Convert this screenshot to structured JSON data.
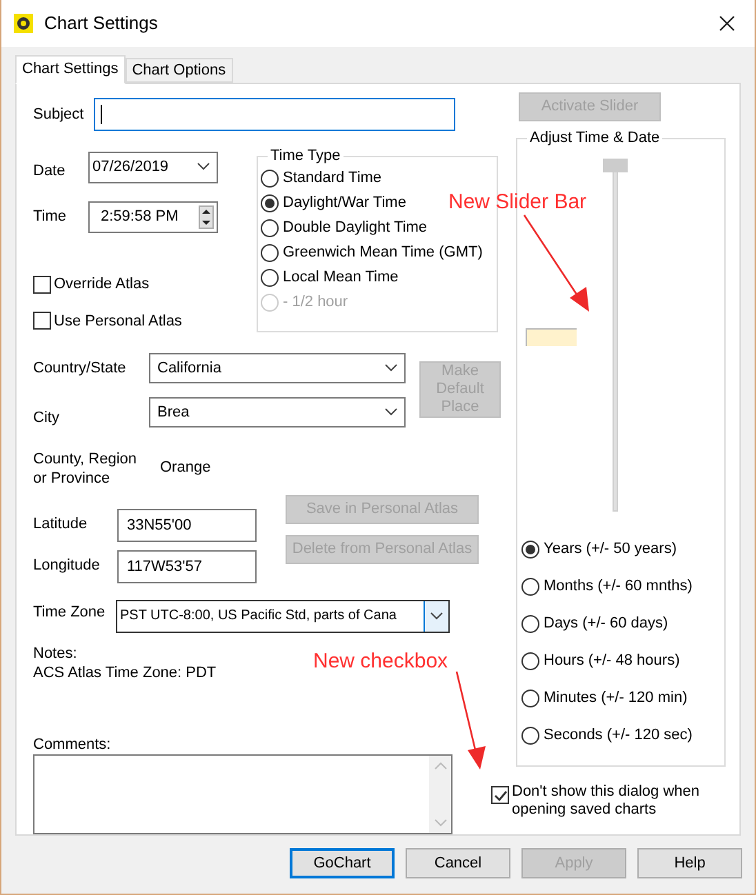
{
  "window": {
    "title": "Chart Settings"
  },
  "tabs": [
    {
      "label": "Chart Settings",
      "selected": true
    },
    {
      "label": "Chart Options",
      "selected": false
    }
  ],
  "subject": {
    "label": "Subject",
    "focused": true
  },
  "date": {
    "label": "Date",
    "value": "07/26/2019"
  },
  "time": {
    "label": "Time",
    "value": "2:59:58 PM"
  },
  "time_type": {
    "title": "Time Type",
    "options": [
      {
        "label": "Standard Time",
        "selected": false,
        "disabled": false
      },
      {
        "label": "Daylight/War Time",
        "selected": true,
        "disabled": false
      },
      {
        "label": "Double Daylight Time",
        "selected": false,
        "disabled": false
      },
      {
        "label": "Greenwich Mean Time (GMT)",
        "selected": false,
        "disabled": false
      },
      {
        "label": "Local Mean Time",
        "selected": false,
        "disabled": false
      },
      {
        "label": "- 1/2 hour",
        "selected": false,
        "disabled": true
      }
    ]
  },
  "checkboxes": [
    {
      "label": "Override Atlas",
      "checked": false
    },
    {
      "label": "Use Personal Atlas",
      "checked": false
    }
  ],
  "country": {
    "label": "Country/State",
    "value": "California"
  },
  "city": {
    "label": "City",
    "value": "Brea"
  },
  "make_default_button": {
    "label": "Make Default Place",
    "disabled": true
  },
  "county": {
    "label": "County, Region or Province",
    "value": "Orange"
  },
  "latitude": {
    "label": "Latitude",
    "value": "33N55'00"
  },
  "longitude": {
    "label": "Longitude",
    "value": "117W53'57"
  },
  "atlas_buttons": [
    {
      "label": "Save in Personal Atlas",
      "disabled": true
    },
    {
      "label": "Delete from Personal Atlas",
      "disabled": true
    }
  ],
  "time_zone": {
    "label": "Time Zone",
    "value": "PST UTC-8:00, US Pacific Std, parts of Cana"
  },
  "notes": {
    "label": "Notes:",
    "text": "ACS Atlas Time Zone: PDT"
  },
  "comments": {
    "label": "Comments:"
  },
  "activate_slider": {
    "label": "Activate Slider",
    "disabled": true
  },
  "adjust": {
    "title": "Adjust Time & Date",
    "slider": {
      "level": 1
    },
    "ranges": [
      {
        "label": "Years (+/- 50 years)",
        "selected": true
      },
      {
        "label": "Months (+/- 60 mnths)",
        "selected": false
      },
      {
        "label": "Days (+/- 60 days)",
        "selected": false
      },
      {
        "label": "Hours (+/- 48 hours)",
        "selected": false
      },
      {
        "label": "Minutes (+/- 120 min)",
        "selected": false
      },
      {
        "label": "Seconds (+/- 120 sec)",
        "selected": false
      }
    ]
  },
  "dont_show": {
    "label": "Don't show this dialog when opening saved charts",
    "checked": true
  },
  "buttons": [
    {
      "label": "GoChart",
      "default": true,
      "disabled": false
    },
    {
      "label": "Cancel",
      "default": false,
      "disabled": false
    },
    {
      "label": "Apply",
      "default": false,
      "disabled": true
    },
    {
      "label": "Help",
      "default": false,
      "disabled": false
    }
  ],
  "annotations": [
    {
      "text": "New Slider Bar"
    },
    {
      "text": "New checkbox"
    }
  ]
}
